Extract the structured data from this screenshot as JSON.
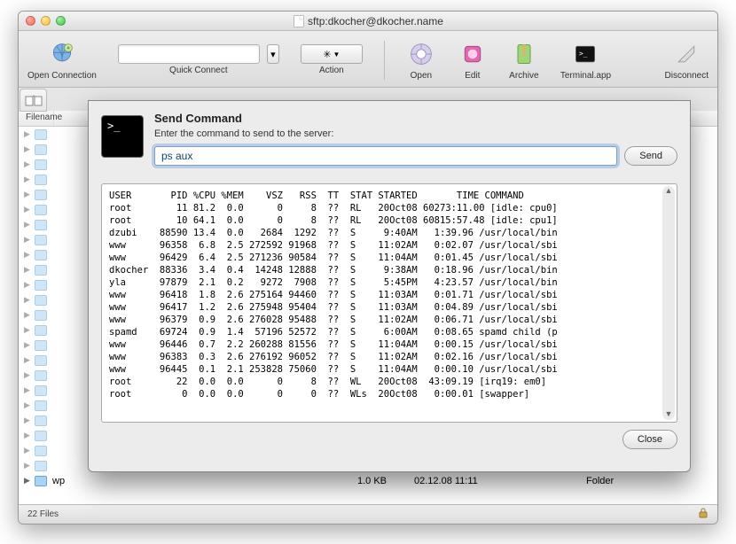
{
  "window": {
    "title": "sftp:dkocher@dkocher.name"
  },
  "toolbar": {
    "open_connection": "Open Connection",
    "quick_connect": "Quick Connect",
    "action": "Action",
    "open": "Open",
    "edit": "Edit",
    "archive": "Archive",
    "terminal": "Terminal.app",
    "disconnect": "Disconnect"
  },
  "columns": {
    "filename": "Filename"
  },
  "rows": [
    {
      "name": "wp",
      "size": "1.0 KB",
      "date": "02.12.08 11:11",
      "kind": "Folder"
    }
  ],
  "status": {
    "count": "22 Files"
  },
  "sheet": {
    "title": "Send Command",
    "prompt": "Enter the command to send to the server:",
    "input": "ps aux",
    "send": "Send",
    "close": "Close",
    "output": "USER       PID %CPU %MEM    VSZ   RSS  TT  STAT STARTED       TIME COMMAND\nroot        11 81.2  0.0      0     8  ??  RL   20Oct08 60273:11.00 [idle: cpu0]\nroot        10 64.1  0.0      0     8  ??  RL   20Oct08 60815:57.48 [idle: cpu1]\ndzubi    88590 13.4  0.0   2684  1292  ??  S     9:40AM   1:39.96 /usr/local/bin\nwww      96358  6.8  2.5 272592 91968  ??  S    11:02AM   0:02.07 /usr/local/sbi\nwww      96429  6.4  2.5 271236 90584  ??  S    11:04AM   0:01.45 /usr/local/sbi\ndkocher  88336  3.4  0.4  14248 12888  ??  S     9:38AM   0:18.96 /usr/local/bin\nyla      97879  2.1  0.2   9272  7908  ??  S     5:45PM   4:23.57 /usr/local/bin\nwww      96418  1.8  2.6 275164 94460  ??  S    11:03AM   0:01.71 /usr/local/sbi\nwww      96417  1.2  2.6 275948 95404  ??  S    11:03AM   0:04.89 /usr/local/sbi\nwww      96379  0.9  2.6 276028 95488  ??  S    11:02AM   0:06.71 /usr/local/sbi\nspamd    69724  0.9  1.4  57196 52572  ??  S     6:00AM   0:08.65 spamd child (p\nwww      96446  0.7  2.2 260288 81556  ??  S    11:04AM   0:00.15 /usr/local/sbi\nwww      96383  0.3  2.6 276192 96052  ??  S    11:02AM   0:02.16 /usr/local/sbi\nwww      96445  0.1  2.1 253828 75060  ??  S    11:04AM   0:00.10 /usr/local/sbi\nroot        22  0.0  0.0      0     8  ??  WL   20Oct08  43:09.19 [irq19: em0]\nroot         0  0.0  0.0      0     0  ??  WLs  20Oct08   0:00.01 [swapper]"
  }
}
